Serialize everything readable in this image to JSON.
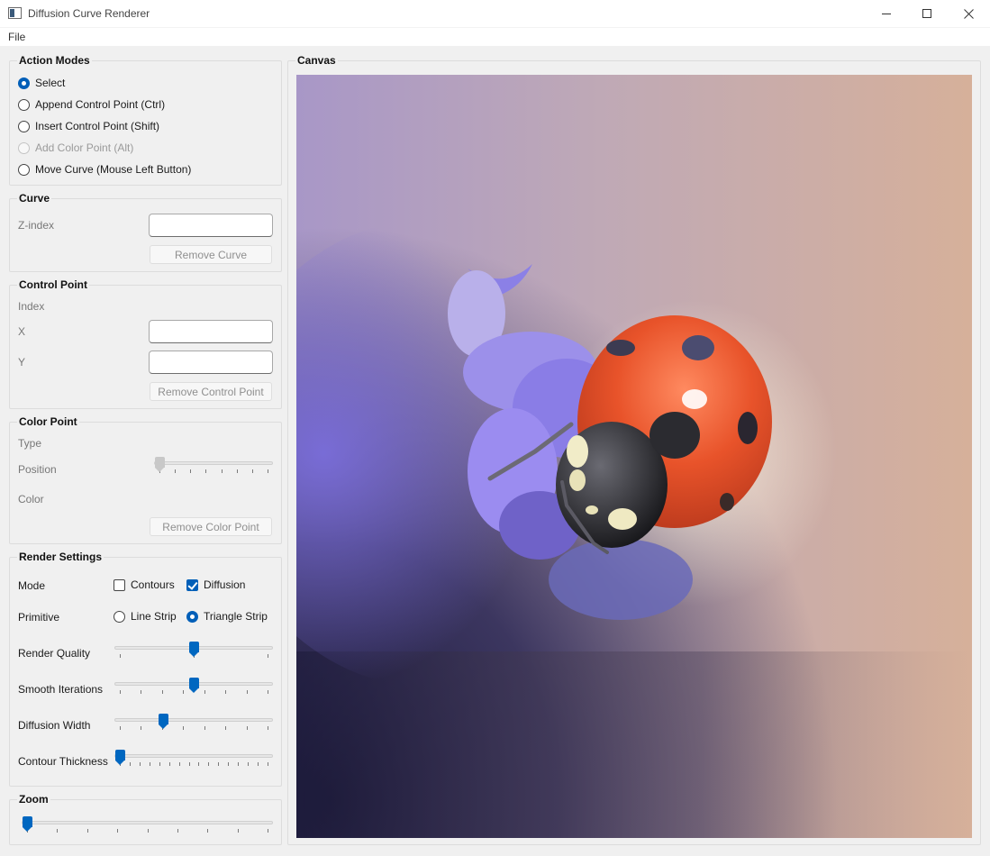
{
  "window": {
    "title": "Diffusion Curve Renderer"
  },
  "menu": {
    "file": "File"
  },
  "action_modes": {
    "title": "Action Modes",
    "options": [
      {
        "label": "Select",
        "selected": true,
        "enabled": true
      },
      {
        "label": "Append Control Point (Ctrl)",
        "selected": false,
        "enabled": true
      },
      {
        "label": "Insert Control Point (Shift)",
        "selected": false,
        "enabled": true
      },
      {
        "label": "Add Color Point (Alt)",
        "selected": false,
        "enabled": false
      },
      {
        "label": "Move Curve (Mouse Left Button)",
        "selected": false,
        "enabled": true
      }
    ]
  },
  "curve": {
    "title": "Curve",
    "z_index_label": "Z-index",
    "z_index_value": "",
    "remove_button": "Remove Curve"
  },
  "control_point": {
    "title": "Control Point",
    "index_label": "Index",
    "x_label": "X",
    "x_value": "",
    "y_label": "Y",
    "y_value": "",
    "remove_button": "Remove Control Point"
  },
  "color_point": {
    "title": "Color Point",
    "type_label": "Type",
    "position_label": "Position",
    "position_value": 0,
    "color_label": "Color",
    "remove_button": "Remove Color Point"
  },
  "render_settings": {
    "title": "Render Settings",
    "mode_label": "Mode",
    "mode_contours": "Contours",
    "mode_contours_checked": false,
    "mode_diffusion": "Diffusion",
    "mode_diffusion_checked": true,
    "primitive_label": "Primitive",
    "primitive_line": "Line Strip",
    "primitive_triangle": "Triangle Strip",
    "primitive_selected": "Triangle Strip",
    "render_quality_label": "Render Quality",
    "render_quality_value": 0.5,
    "smooth_iterations_label": "Smooth Iterations",
    "smooth_iterations_value": 0.5,
    "diffusion_width_label": "Diffusion Width",
    "diffusion_width_value": 0.29,
    "contour_thickness_label": "Contour Thickness",
    "contour_thickness_value": 0.0
  },
  "zoom": {
    "title": "Zoom",
    "value": 0.0
  },
  "canvas": {
    "title": "Canvas"
  },
  "colors": {
    "accent": "#0067c0",
    "ladybug_red": "#e2522a",
    "background_violet": "#8b7fd6",
    "background_peach": "#d9b39a",
    "background_dark": "#1a1838"
  }
}
